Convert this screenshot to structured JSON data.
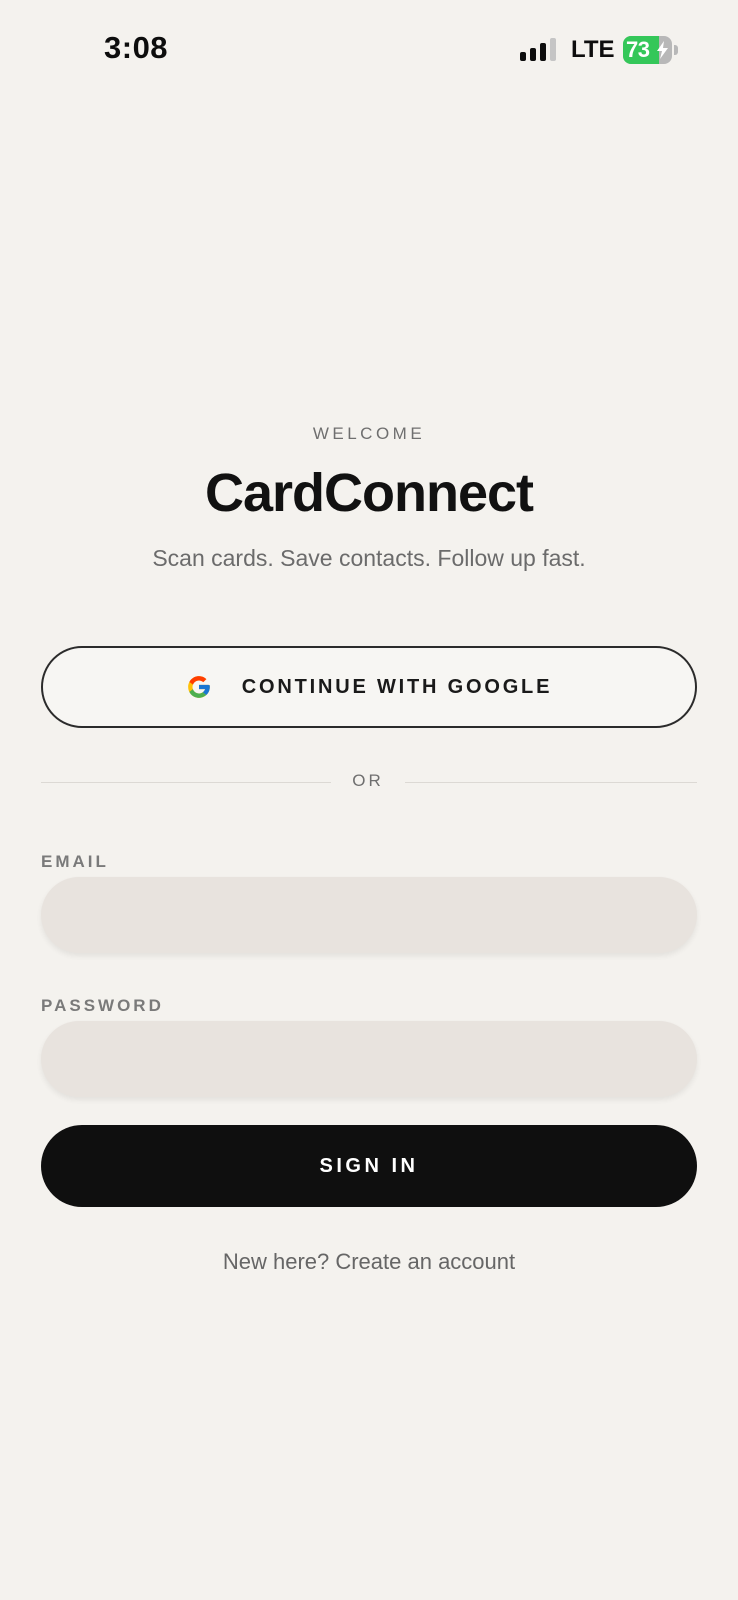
{
  "status_bar": {
    "time": "3:08",
    "network": "LTE",
    "battery_level": "73",
    "battery_fraction": 0.73,
    "battery_color": "#34c759",
    "signal_bars_active": 3,
    "signal_bars_total": 4,
    "icons": [
      "signal-icon",
      "battery-icon",
      "charging-bolt-icon"
    ]
  },
  "header": {
    "eyebrow": "WELCOME",
    "title": "CardConnect",
    "tagline": "Scan cards. Save contacts. Follow up fast."
  },
  "google_button": {
    "label": "CONTINUE WITH GOOGLE",
    "icon": "google-icon"
  },
  "divider": {
    "label": "OR"
  },
  "form": {
    "email": {
      "label": "EMAIL",
      "value": "",
      "placeholder": ""
    },
    "password": {
      "label": "PASSWORD",
      "value": "",
      "placeholder": ""
    },
    "submit_label": "SIGN IN"
  },
  "footer": {
    "create_account": "New here? Create an account"
  },
  "colors": {
    "background": "#f4f2ee",
    "primary_button": "#0f0f0f",
    "input_fill": "#e8e3de"
  }
}
